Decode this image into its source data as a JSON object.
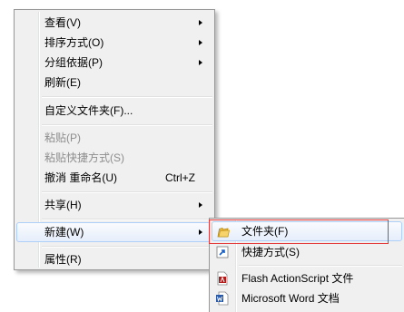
{
  "context_menu": {
    "items": [
      {
        "label": "查看(V)",
        "has_submenu": true
      },
      {
        "label": "排序方式(O)",
        "has_submenu": true
      },
      {
        "label": "分组依据(P)",
        "has_submenu": true
      },
      {
        "label": "刷新(E)"
      },
      {
        "label": "自定义文件夹(F)..."
      },
      {
        "label": "粘贴(P)",
        "disabled": true
      },
      {
        "label": "粘贴快捷方式(S)",
        "disabled": true
      },
      {
        "label": "撤消 重命名(U)",
        "shortcut": "Ctrl+Z"
      },
      {
        "label": "共享(H)",
        "has_submenu": true
      },
      {
        "label": "新建(W)",
        "has_submenu": true,
        "highlighted": true
      },
      {
        "label": "属性(R)"
      }
    ]
  },
  "new_submenu": {
    "items": [
      {
        "label": "文件夹(F)",
        "icon": "folder-icon",
        "highlighted": true
      },
      {
        "label": "快捷方式(S)",
        "icon": "shortcut-icon"
      },
      {
        "label": "Flash ActionScript 文件",
        "icon": "flash-actionscript-file-icon"
      },
      {
        "label": "Microsoft Word 文档",
        "icon": "word-document-icon"
      }
    ]
  },
  "colors": {
    "menu_background": "#f0f0f0",
    "menu_border": "#979797",
    "hover_border": "#aecff7",
    "disabled_text": "#8d8d8d",
    "annotation_red": "#e23a3a"
  }
}
